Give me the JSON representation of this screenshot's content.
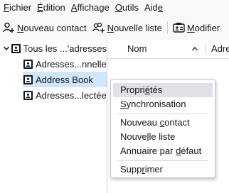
{
  "menubar": [
    {
      "pre": "",
      "acc": "F",
      "post": "ichier",
      "name": "menu-fichier"
    },
    {
      "pre": "",
      "acc": "É",
      "post": "dition",
      "name": "menu-edition"
    },
    {
      "pre": "",
      "acc": "A",
      "post": "ffichage",
      "name": "menu-affichage"
    },
    {
      "pre": "",
      "acc": "O",
      "post": "utils",
      "name": "menu-outils"
    },
    {
      "pre": "Aid",
      "acc": "e",
      "post": "",
      "name": "menu-aide"
    }
  ],
  "toolbar": {
    "new_contact": {
      "pre": "",
      "acc": "N",
      "post": "ouveau contact",
      "icon": "new-contact-icon"
    },
    "new_list": {
      "pre": "",
      "acc": "N",
      "post": "ouvelle liste",
      "icon": "new-list-icon"
    },
    "edit": {
      "pre": "",
      "acc": "M",
      "post": "odifier",
      "icon": "contact-card-icon"
    }
  },
  "tree": {
    "root": {
      "label": "Tous les ...'adresses",
      "expanded": true
    },
    "books": [
      {
        "label": "Adresses...nnelles",
        "selected": false
      },
      {
        "label": "Address Book",
        "selected": true
      },
      {
        "label": "Adresses...lectées",
        "selected": false
      }
    ]
  },
  "columns": [
    "Nom",
    "Adre"
  ],
  "sort_indicator": "chevron-up",
  "context_menu": {
    "items": [
      {
        "pre": "Propri",
        "acc": "é",
        "post": "tés",
        "hover": true
      },
      {
        "pre": "",
        "acc": "S",
        "post": "ynchronisation",
        "hover": false
      },
      {
        "pre": "Nouveau ",
        "acc": "c",
        "post": "ontact",
        "hover": false
      },
      {
        "pre": "Nouve",
        "acc": "l",
        "post": "le liste",
        "hover": false
      },
      {
        "pre": "Annuaire par ",
        "acc": "d",
        "post": "éfaut",
        "hover": false
      },
      {
        "pre": "Supp",
        "acc": "r",
        "post": "imer",
        "hover": false
      }
    ]
  },
  "colors": {
    "accent_selection": "#cfe6fb",
    "menu_hover": "#e0e0e6",
    "background": "#f9f9fb"
  }
}
